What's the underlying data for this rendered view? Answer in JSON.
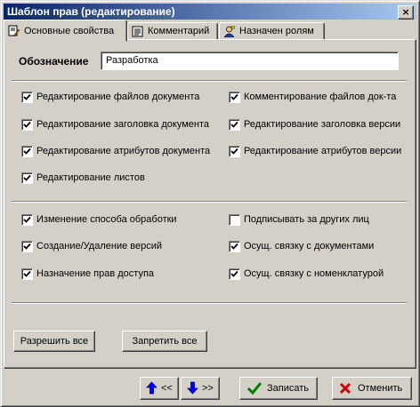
{
  "window": {
    "title": "Шаблон прав (редактирование)",
    "close_label": "×"
  },
  "tabs": [
    {
      "label": "Основные свойства",
      "icon": "properties-icon",
      "active": true
    },
    {
      "label": "Комментарий",
      "icon": "comment-icon",
      "active": false
    },
    {
      "label": "Назначен ролям",
      "icon": "roles-icon",
      "active": false
    }
  ],
  "designation": {
    "label": "Обозначение",
    "value": "Разработка"
  },
  "doc_permissions": {
    "left": [
      {
        "label": "Редактирование файлов документа",
        "checked": true
      },
      {
        "label": "Редактирование заголовка документа",
        "checked": true
      },
      {
        "label": "Редактирование атрибутов документа",
        "checked": true
      },
      {
        "label": "Редактирование листов",
        "checked": true
      }
    ],
    "right": [
      {
        "label": "Комментирование файлов док-та",
        "checked": true
      },
      {
        "label": "Редактирование заголовка версии",
        "checked": true
      },
      {
        "label": "Редактирование атрибутов версии",
        "checked": true
      }
    ]
  },
  "other_permissions": {
    "left": [
      {
        "label": "Изменение способа обработки",
        "checked": true
      },
      {
        "label": "Создание/Удаление версий",
        "checked": true
      },
      {
        "label": "Назначение прав доступа",
        "checked": true
      }
    ],
    "right": [
      {
        "label": "Подписывать за других лиц",
        "checked": false
      },
      {
        "label": "Осущ. связку с документами",
        "checked": true
      },
      {
        "label": "Осущ. связку с номенклатурой",
        "checked": true
      }
    ]
  },
  "actions": {
    "allow_all": "Разрешить все",
    "deny_all": "Запретить все"
  },
  "footer": {
    "prev_label": "<<",
    "next_label": ">>",
    "save_label": "Записать",
    "cancel_label": "Отменить"
  },
  "colors": {
    "title_start": "#0a246a",
    "title_end": "#a6caf0",
    "face": "#d4d0c8",
    "arrow_blue": "#0000ff",
    "check_green": "#008000",
    "cancel_red": "#d00000"
  }
}
